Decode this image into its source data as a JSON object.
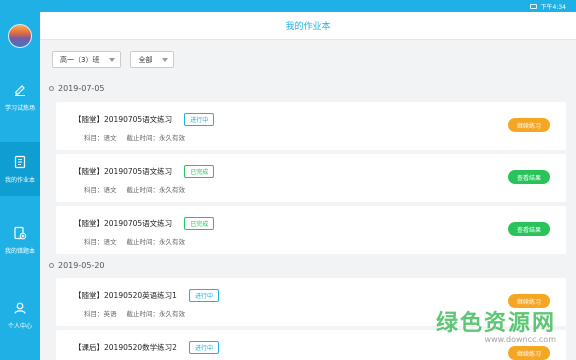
{
  "statusbar": {
    "time": "下午4:34"
  },
  "sidebar": {
    "items": [
      {
        "label": "学习试炼场",
        "icon": "pencil-icon",
        "active": false
      },
      {
        "label": "我的作业本",
        "icon": "book-icon",
        "active": true
      },
      {
        "label": "我的错题本",
        "icon": "error-book-icon",
        "active": false
      },
      {
        "label": "个人中心",
        "icon": "user-icon",
        "active": false
      }
    ]
  },
  "header": {
    "title": "我的作业本"
  },
  "filters": {
    "class_select": "高一（3）班",
    "subject_select": "全部"
  },
  "groups": [
    {
      "date": "2019-07-05",
      "items": [
        {
          "title": "【随堂】20190705语文练习",
          "status": "进行中",
          "subject": "科目：语文",
          "deadline": "截止时间：永久有效",
          "action": "继续练习"
        },
        {
          "title": "【随堂】20190705语文练习",
          "status": "已完成",
          "subject": "科目：语文",
          "deadline": "截止时间：永久有效",
          "action": "查看结果"
        },
        {
          "title": "【随堂】20190705语文练习",
          "status": "已完成",
          "subject": "科目：语文",
          "deadline": "截止时间：永久有效",
          "action": "查看结果"
        }
      ]
    },
    {
      "date": "2019-05-20",
      "items": [
        {
          "title": "【随堂】20190520英语练习1",
          "status": "进行中",
          "subject": "科目：英语",
          "deadline": "截止时间：永久有效",
          "action": "继续练习"
        },
        {
          "title": "【课后】20190520数学练习2",
          "status": "进行中",
          "subject": "",
          "deadline": "",
          "action": "继续练习"
        }
      ]
    }
  ],
  "watermark": {
    "text": "绿色资源网",
    "url": "www.downcc.com"
  },
  "colors": {
    "primary": "#1fb1e6",
    "orange": "#f5a623",
    "green": "#28c35a"
  }
}
